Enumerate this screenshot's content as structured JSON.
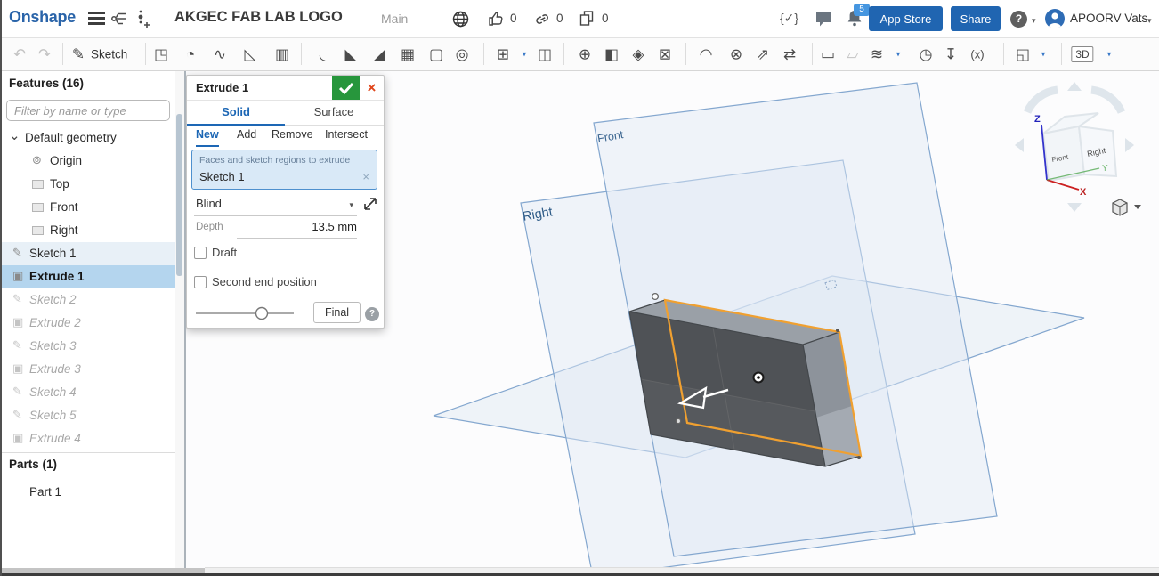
{
  "topbar": {
    "logo": "Onshape",
    "document_title": "AKGEC FAB LAB LOGO",
    "workspace": "Main",
    "like_count": "0",
    "link_count": "0",
    "copy_count": "0",
    "notification_count": "5",
    "code_check_glyph": "{✓}",
    "app_store_label": "App Store",
    "share_label": "Share",
    "help_glyph": "?",
    "user_name": "APOORV Vats"
  },
  "toolbar": {
    "items": [
      {
        "name": "undo-icon",
        "glyph": "↶",
        "disabled": true
      },
      {
        "name": "redo-icon",
        "glyph": "↷",
        "disabled": true
      },
      {
        "name": "sketch-button",
        "glyph": "✎",
        "label": "Sketch"
      },
      {
        "name": "extrude-icon",
        "glyph": "◳"
      },
      {
        "name": "revolve-icon",
        "glyph": "◔"
      },
      {
        "name": "sweep-icon",
        "glyph": "∿"
      },
      {
        "name": "loft-icon",
        "glyph": "◺"
      },
      {
        "name": "thicken-icon",
        "glyph": "▥"
      },
      {
        "name": "fillet-icon",
        "glyph": "◟"
      },
      {
        "name": "chamfer-icon",
        "glyph": "◣"
      },
      {
        "name": "draft-icon",
        "glyph": "◢"
      },
      {
        "name": "rib-icon",
        "glyph": "▦"
      },
      {
        "name": "shell-icon",
        "glyph": "▢"
      },
      {
        "name": "hole-icon",
        "glyph": "◎"
      },
      {
        "name": "linear-pattern-icon",
        "glyph": "⊞",
        "caret": true
      },
      {
        "name": "mirror-icon",
        "glyph": "◫"
      },
      {
        "name": "boolean-icon",
        "glyph": "⊕"
      },
      {
        "name": "split-icon",
        "glyph": "◧"
      },
      {
        "name": "transform-icon",
        "glyph": "◈"
      },
      {
        "name": "delete-part-icon",
        "glyph": "⊠"
      },
      {
        "name": "modify-fillet-icon",
        "glyph": "◠"
      },
      {
        "name": "delete-face-icon",
        "glyph": "⊗"
      },
      {
        "name": "move-face-icon",
        "glyph": "⇗"
      },
      {
        "name": "replace-face-icon",
        "glyph": "⇄"
      },
      {
        "name": "offset-surface-icon",
        "glyph": "▭"
      },
      {
        "name": "plane-icon",
        "glyph": "▱",
        "disabled": true
      },
      {
        "name": "helix-icon",
        "glyph": "≋",
        "caret": true
      },
      {
        "name": "measure-icon",
        "glyph": "◷"
      },
      {
        "name": "import-icon",
        "glyph": "↧"
      },
      {
        "name": "variable-icon",
        "glyph": "(x)"
      },
      {
        "name": "section-view-icon",
        "glyph": "◱",
        "caret": true
      },
      {
        "name": "named-views-button",
        "glyph": "3D",
        "caret": true,
        "boxed": true
      }
    ]
  },
  "sidebar": {
    "features_header": "Features (16)",
    "filter_placeholder": "Filter by name or type",
    "tree": [
      {
        "label": "Default geometry",
        "icon": "chevron-down",
        "glyph": "⌄",
        "level": 0,
        "state": "group"
      },
      {
        "label": "Origin",
        "icon": "origin",
        "glyph": "⊚",
        "level": 2,
        "state": "normal"
      },
      {
        "label": "Top",
        "icon": "plane",
        "glyph": "",
        "level": 2,
        "state": "normal"
      },
      {
        "label": "Front",
        "icon": "plane",
        "glyph": "",
        "level": 2,
        "state": "normal"
      },
      {
        "label": "Right",
        "icon": "plane",
        "glyph": "",
        "level": 2,
        "state": "normal"
      },
      {
        "label": "Sketch 1",
        "icon": "sketch",
        "glyph": "✎",
        "level": 1,
        "state": "highlighted"
      },
      {
        "label": "Extrude 1",
        "icon": "extrude",
        "glyph": "▣",
        "level": 1,
        "state": "selected"
      },
      {
        "label": "Sketch 2",
        "icon": "sketch",
        "glyph": "✎",
        "level": 1,
        "state": "suppressed"
      },
      {
        "label": "Extrude 2",
        "icon": "extrude",
        "glyph": "▣",
        "level": 1,
        "state": "suppressed"
      },
      {
        "label": "Sketch 3",
        "icon": "sketch",
        "glyph": "✎",
        "level": 1,
        "state": "suppressed"
      },
      {
        "label": "Extrude 3",
        "icon": "extrude",
        "glyph": "▣",
        "level": 1,
        "state": "suppressed"
      },
      {
        "label": "Sketch 4",
        "icon": "sketch",
        "glyph": "✎",
        "level": 1,
        "state": "suppressed"
      },
      {
        "label": "Sketch 5",
        "icon": "sketch",
        "glyph": "✎",
        "level": 1,
        "state": "suppressed"
      },
      {
        "label": "Extrude 4",
        "icon": "extrude",
        "glyph": "▣",
        "level": 1,
        "state": "suppressed"
      }
    ],
    "parts_header": "Parts (1)",
    "parts": [
      {
        "label": "Part 1"
      }
    ]
  },
  "dialog": {
    "title": "Extrude 1",
    "tabs": [
      "Solid",
      "Surface"
    ],
    "active_tab": "Solid",
    "modes": [
      "New",
      "Add",
      "Remove",
      "Intersect"
    ],
    "active_mode": "New",
    "selection_label": "Faces and sketch regions to extrude",
    "selection_value": "Sketch 1",
    "clear_glyph": "×",
    "cancel_glyph": "×",
    "end_type": "Blind",
    "depth_label": "Depth",
    "depth_value": "13.5 mm",
    "draft_label": "Draft",
    "second_end_label": "Second end position",
    "final_label": "Final",
    "help_glyph": "?"
  },
  "viewport": {
    "plane_labels": {
      "front": "Front",
      "right": "Right"
    },
    "view_cube": {
      "front": "Front",
      "right": "Right",
      "axis_x": "X",
      "axis_y": "Y",
      "axis_z": "Z"
    }
  },
  "colors": {
    "accent_blue": "#2065b1",
    "selection_blue": "#b4d5ee",
    "highlight_orange": "#f0a030",
    "confirm_green": "#27963c",
    "cancel_red": "#e0471c",
    "badge_blue": "#4596e0"
  }
}
